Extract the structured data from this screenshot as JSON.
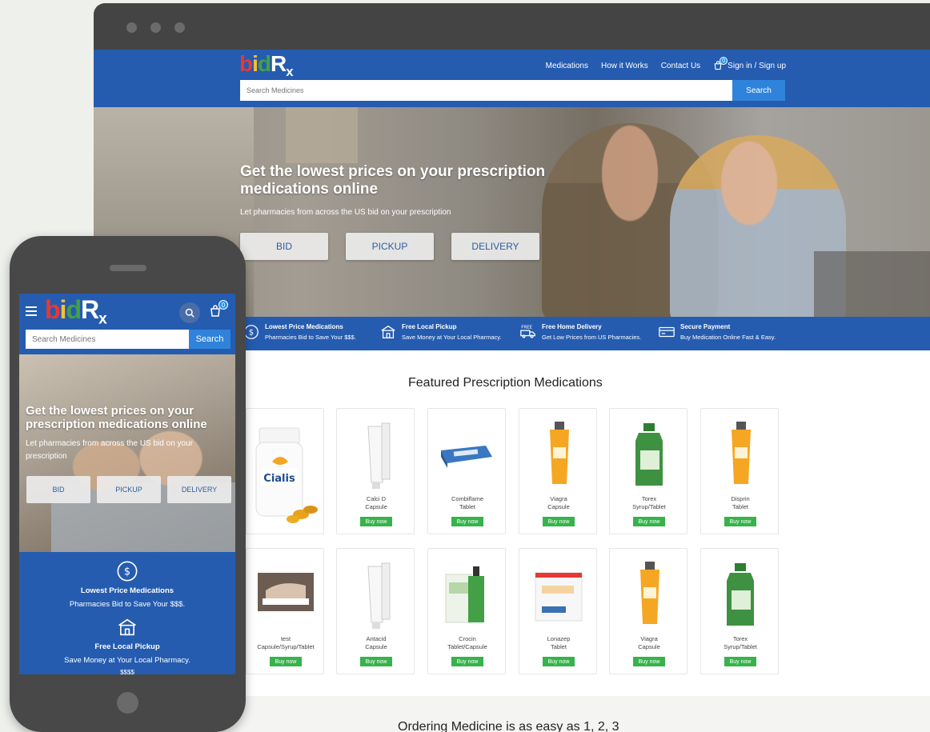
{
  "desktop": {
    "logo": {
      "b": "b",
      "i": "i",
      "d": "d",
      "r": "R",
      "x": "x"
    },
    "nav": {
      "items": [
        "Medications",
        "How it Works",
        "Contact Us"
      ],
      "cart_count": "0",
      "sign_in": "Sign in / Sign up"
    },
    "search": {
      "placeholder": "Search Medicines",
      "button": "Search"
    },
    "hero": {
      "title": "Get the lowest prices on your prescription medications online",
      "subtitle": "Let pharmacies from across the US bid on your prescription",
      "buttons": [
        "BID",
        "PICKUP",
        "DELIVERY"
      ]
    },
    "features": [
      {
        "icon": "dollar-circle-icon",
        "title": "Lowest Price Medications",
        "desc": "Pharmacies Bid to Save Your $$$."
      },
      {
        "icon": "store-icon",
        "title": "Free Local Pickup",
        "desc": "Save Money at Your Local Pharmacy."
      },
      {
        "icon": "delivery-truck-icon",
        "title": "Free Home Delivery",
        "desc": "Get Low Prices from US Pharmacies.",
        "icon_label": "FREE"
      },
      {
        "icon": "credit-card-icon",
        "title": "Secure Payment",
        "desc": "Buy Medication Online Fast & Easy."
      }
    ],
    "featured_title": "Featured Prescription Medications",
    "buy_label": "Buy now",
    "products_row1": [
      {
        "name1": "",
        "name2": "",
        "image": "cialis-bottle",
        "brand": "Cialis"
      },
      {
        "name1": "Calci D",
        "name2": "Capsule",
        "image": "white-tube"
      },
      {
        "name1": "Combiflame",
        "name2": "Tablet",
        "image": "blister-pack"
      },
      {
        "name1": "Viagra",
        "name2": "Capsule",
        "image": "orange-tube"
      },
      {
        "name1": "Torex",
        "name2": "Syrup/Tablet",
        "image": "green-bottle"
      },
      {
        "name1": "Disprin",
        "name2": "Tablet",
        "image": "orange-tube"
      }
    ],
    "products_row2": [
      {
        "name1": "test",
        "name2": "Capsule/Syrup/Tablet",
        "image": "photo"
      },
      {
        "name1": "Antacid",
        "name2": "Capsule",
        "image": "white-tube"
      },
      {
        "name1": "Crocin",
        "name2": "Tablet/Capsule",
        "image": "dropper-box"
      },
      {
        "name1": "Lonazep",
        "name2": "Tablet",
        "image": "tablet-box"
      },
      {
        "name1": "Viagra",
        "name2": "Capsule",
        "image": "orange-tube"
      },
      {
        "name1": "Torex",
        "name2": "Syrup/Tablet",
        "image": "green-bottle"
      }
    ],
    "order_title": "Ordering Medicine is as easy as 1, 2, 3"
  },
  "mobile": {
    "cart_count": "0",
    "search": {
      "placeholder": "Search Medicines",
      "button": "Search"
    },
    "hero": {
      "title": "Get the lowest prices on your prescription medications online",
      "subtitle": "Let pharmacies from across the US bid on your prescription",
      "buttons": [
        "BID",
        "PICKUP",
        "DELIVERY"
      ]
    },
    "features": [
      {
        "title": "Lowest Price Medications",
        "desc": "Pharmacies Bid to Save Your $$$."
      },
      {
        "title": "Free Local Pickup",
        "desc": "Save Money at Your Local Pharmacy."
      }
    ],
    "partial_text": "$$$$"
  },
  "colors": {
    "brand_blue": "#255cb0",
    "search_blue": "#2f83db",
    "buy_green": "#36b34a",
    "logo_red": "#e53935",
    "logo_yellow": "#fbc02d",
    "logo_green": "#43a047"
  }
}
